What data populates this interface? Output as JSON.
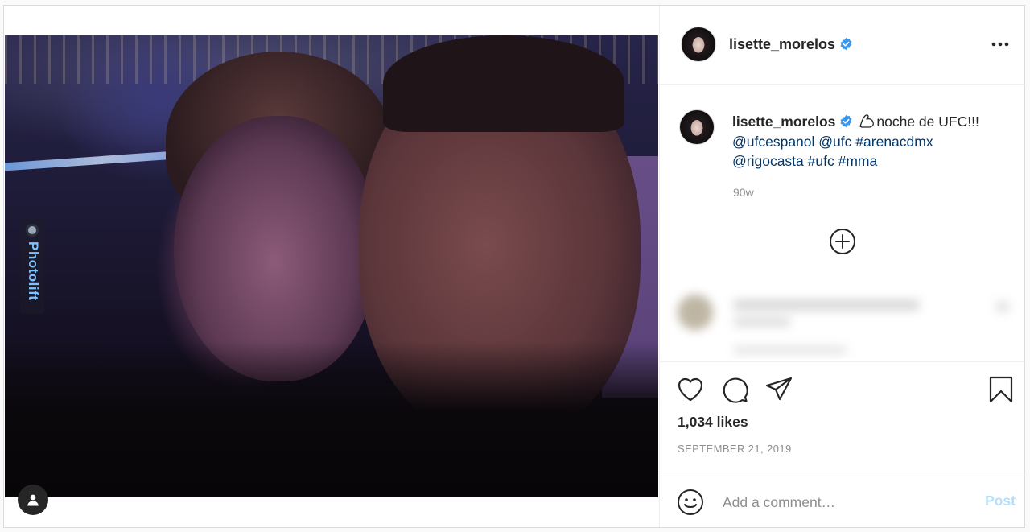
{
  "post": {
    "username": "lisette_morelos",
    "verified": true,
    "caption": {
      "username": "lisette_morelos",
      "emoji": "flexed-biceps",
      "text": "noche de UFC!!!",
      "mentions_line1": [
        "@ufcespanol",
        "@ufc",
        "#arenacdmx"
      ],
      "mentions_line2": [
        "@rigocasta",
        "#ufc",
        "#mma"
      ],
      "time_ago": "90w"
    },
    "likes": "1,034 likes",
    "date": "SEPTEMBER 21, 2019",
    "watermark": "Photolift"
  },
  "comment_box": {
    "placeholder": "Add a comment…",
    "post_label": "Post"
  },
  "icons": {
    "more": "more-horizontal-icon",
    "verified": "verified-badge-icon",
    "load_more": "plus-circle-icon",
    "like": "heart-icon",
    "comment": "comment-bubble-icon",
    "share": "paper-plane-icon",
    "save": "bookmark-icon",
    "emoji": "smiley-icon",
    "tag": "user-tag-icon"
  },
  "colors": {
    "link": "#00376b",
    "verified": "#3897f0",
    "post_button": "#b2dffc",
    "muted": "#8e8e8e"
  }
}
